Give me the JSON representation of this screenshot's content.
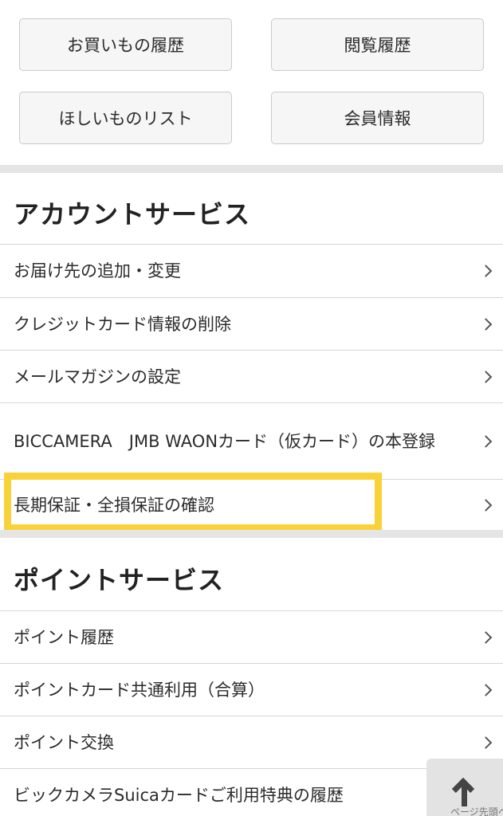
{
  "top_buttons": [
    {
      "label": "お買いもの履歴"
    },
    {
      "label": "閲覧履歴"
    },
    {
      "label": "ほしいものリスト"
    },
    {
      "label": "会員情報"
    }
  ],
  "account_section": {
    "title": "アカウントサービス",
    "items": [
      {
        "label": "お届け先の追加・変更"
      },
      {
        "label": "クレジットカード情報の削除"
      },
      {
        "label": "メールマガジンの設定"
      },
      {
        "label": "BICCAMERA　JMB WAONカード（仮カード）の本登録"
      },
      {
        "label": "長期保証・全損保証の確認"
      }
    ]
  },
  "point_section": {
    "title": "ポイントサービス",
    "items": [
      {
        "label": "ポイント履歴"
      },
      {
        "label": "ポイントカード共通利用（合算）"
      },
      {
        "label": "ポイント交換"
      },
      {
        "label": "ビックカメラSuicaカードご利用特典の履歴"
      }
    ]
  },
  "back_to_top": {
    "label": "ページ先頭へ",
    "icon": "arrow-up-icon"
  },
  "colors": {
    "highlight": "#f9d23a",
    "band": "#e5e5e5",
    "chevron": "#555555"
  }
}
